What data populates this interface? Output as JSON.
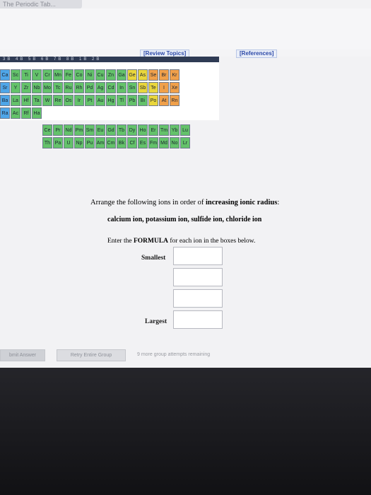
{
  "browser": {
    "tab_title": "The Periodic Tab..."
  },
  "links": {
    "review_topics": "[Review Topics]",
    "references": "[References]"
  },
  "periodic_table": {
    "header": "3B 4B 5B 6B 7B 8B 1B 2B",
    "rows": [
      [
        {
          "s": "Ca",
          "c": "b"
        },
        {
          "s": "Sc",
          "c": "g"
        },
        {
          "s": "Ti",
          "c": "g"
        },
        {
          "s": "V",
          "c": "g"
        },
        {
          "s": "Cr",
          "c": "g"
        },
        {
          "s": "Mn",
          "c": "g"
        },
        {
          "s": "Fe",
          "c": "g"
        },
        {
          "s": "Co",
          "c": "g"
        },
        {
          "s": "Ni",
          "c": "g"
        },
        {
          "s": "Cu",
          "c": "g"
        },
        {
          "s": "Zn",
          "c": "g"
        },
        {
          "s": "Ga",
          "c": "g"
        },
        {
          "s": "Ge",
          "c": "y"
        },
        {
          "s": "As",
          "c": "y"
        },
        {
          "s": "Se",
          "c": "o"
        },
        {
          "s": "Br",
          "c": "o"
        },
        {
          "s": "Kr",
          "c": "o"
        }
      ],
      [
        {
          "s": "Sr",
          "c": "b"
        },
        {
          "s": "Y",
          "c": "g"
        },
        {
          "s": "Zr",
          "c": "g"
        },
        {
          "s": "Nb",
          "c": "g"
        },
        {
          "s": "Mo",
          "c": "g"
        },
        {
          "s": "Tc",
          "c": "g"
        },
        {
          "s": "Ru",
          "c": "g"
        },
        {
          "s": "Rh",
          "c": "g"
        },
        {
          "s": "Pd",
          "c": "g"
        },
        {
          "s": "Ag",
          "c": "g"
        },
        {
          "s": "Cd",
          "c": "g"
        },
        {
          "s": "In",
          "c": "g"
        },
        {
          "s": "Sn",
          "c": "g"
        },
        {
          "s": "Sb",
          "c": "y"
        },
        {
          "s": "Te",
          "c": "y"
        },
        {
          "s": "I",
          "c": "o"
        },
        {
          "s": "Xe",
          "c": "o"
        }
      ],
      [
        {
          "s": "Ba",
          "c": "b"
        },
        {
          "s": "La",
          "c": "g"
        },
        {
          "s": "Hf",
          "c": "g"
        },
        {
          "s": "Ta",
          "c": "g"
        },
        {
          "s": "W",
          "c": "g"
        },
        {
          "s": "Re",
          "c": "g"
        },
        {
          "s": "Os",
          "c": "g"
        },
        {
          "s": "Ir",
          "c": "g"
        },
        {
          "s": "Pt",
          "c": "g"
        },
        {
          "s": "Au",
          "c": "g"
        },
        {
          "s": "Hg",
          "c": "g"
        },
        {
          "s": "Tl",
          "c": "g"
        },
        {
          "s": "Pb",
          "c": "g"
        },
        {
          "s": "Bi",
          "c": "g"
        },
        {
          "s": "Po",
          "c": "y"
        },
        {
          "s": "At",
          "c": "o"
        },
        {
          "s": "Rn",
          "c": "o"
        }
      ],
      [
        {
          "s": "Ra",
          "c": "b"
        },
        {
          "s": "Ac",
          "c": "g"
        },
        {
          "s": "Rf",
          "c": "g"
        },
        {
          "s": "Ha",
          "c": "g"
        }
      ]
    ],
    "f_rows": [
      [
        {
          "s": "Ce",
          "c": "g"
        },
        {
          "s": "Pr",
          "c": "g"
        },
        {
          "s": "Nd",
          "c": "g"
        },
        {
          "s": "Pm",
          "c": "g"
        },
        {
          "s": "Sm",
          "c": "g"
        },
        {
          "s": "Eu",
          "c": "g"
        },
        {
          "s": "Gd",
          "c": "g"
        },
        {
          "s": "Tb",
          "c": "g"
        },
        {
          "s": "Dy",
          "c": "g"
        },
        {
          "s": "Ho",
          "c": "g"
        },
        {
          "s": "Er",
          "c": "g"
        },
        {
          "s": "Tm",
          "c": "g"
        },
        {
          "s": "Yb",
          "c": "g"
        },
        {
          "s": "Lu",
          "c": "g"
        }
      ],
      [
        {
          "s": "Th",
          "c": "g"
        },
        {
          "s": "Pa",
          "c": "g"
        },
        {
          "s": "U",
          "c": "g"
        },
        {
          "s": "Np",
          "c": "g"
        },
        {
          "s": "Pu",
          "c": "g"
        },
        {
          "s": "Am",
          "c": "g"
        },
        {
          "s": "Cm",
          "c": "g"
        },
        {
          "s": "Bk",
          "c": "g"
        },
        {
          "s": "Cf",
          "c": "g"
        },
        {
          "s": "Es",
          "c": "g"
        },
        {
          "s": "Fm",
          "c": "g"
        },
        {
          "s": "Md",
          "c": "g"
        },
        {
          "s": "No",
          "c": "g"
        },
        {
          "s": "Lr",
          "c": "g"
        }
      ]
    ]
  },
  "question": {
    "instruction_prefix": "Arrange the following ions in order of ",
    "instruction_bold": "increasing ionic radius",
    "instruction_suffix": ":",
    "ions": "calcium ion, potassium ion, sulfide ion, chloride ion",
    "enter_prefix": "Enter the ",
    "enter_bold": "FORMULA",
    "enter_suffix": " for each ion in the boxes below.",
    "smallest_label": "Smallest",
    "largest_label": "Largest",
    "answers": [
      "",
      "",
      "",
      ""
    ]
  },
  "footer": {
    "submit_label": "bmit Answer",
    "retry_label": "Retry Entire Group",
    "remaining_text": "9 more group attempts remaining"
  },
  "colors": {
    "s_block": "#4fa6e8",
    "d_block": "#64c26a",
    "metalloid": "#e9d63c",
    "nonmetal": "#f0a04a"
  }
}
